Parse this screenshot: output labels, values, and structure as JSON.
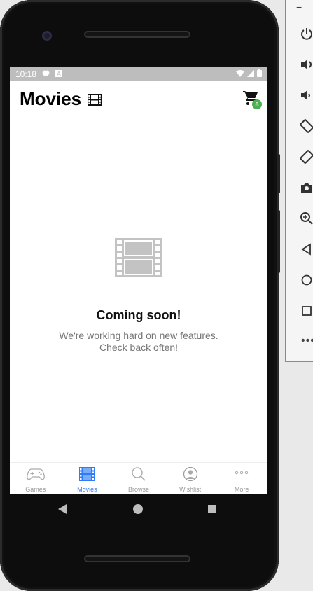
{
  "status_bar": {
    "time": "10:18",
    "icons": [
      "settings-icon",
      "a-icon",
      "wifi-icon",
      "signal-icon",
      "battery-icon"
    ]
  },
  "header": {
    "title": "Movies",
    "title_icon": "film-icon",
    "cart_icon": "shopping-cart-icon",
    "cart_count": "8"
  },
  "empty_state": {
    "icon": "film-icon",
    "title": "Coming soon!",
    "message_line1": "We're working hard on new features.",
    "message_line2": "Check back often!"
  },
  "tabs": [
    {
      "label": "Games",
      "icon": "gamepad-icon",
      "active": false
    },
    {
      "label": "Movies",
      "icon": "film-icon",
      "active": true
    },
    {
      "label": "Browse",
      "icon": "search-icon",
      "active": false
    },
    {
      "label": "Wishlist",
      "icon": "avatar-icon",
      "active": false
    },
    {
      "label": "More",
      "icon": "more-dots-icon",
      "active": false
    }
  ],
  "emulator_panel": {
    "items": [
      "power-icon",
      "volume-up-icon",
      "volume-down-icon",
      "rotate-left-icon",
      "rotate-right-icon",
      "camera-icon",
      "zoom-icon",
      "back-icon",
      "home-icon",
      "overview-icon",
      "more-icon"
    ]
  },
  "colors": {
    "accent": "#2f7cf6",
    "badge": "#4caf50",
    "status_bar": "#bdbdbd",
    "muted_text": "#757575"
  }
}
